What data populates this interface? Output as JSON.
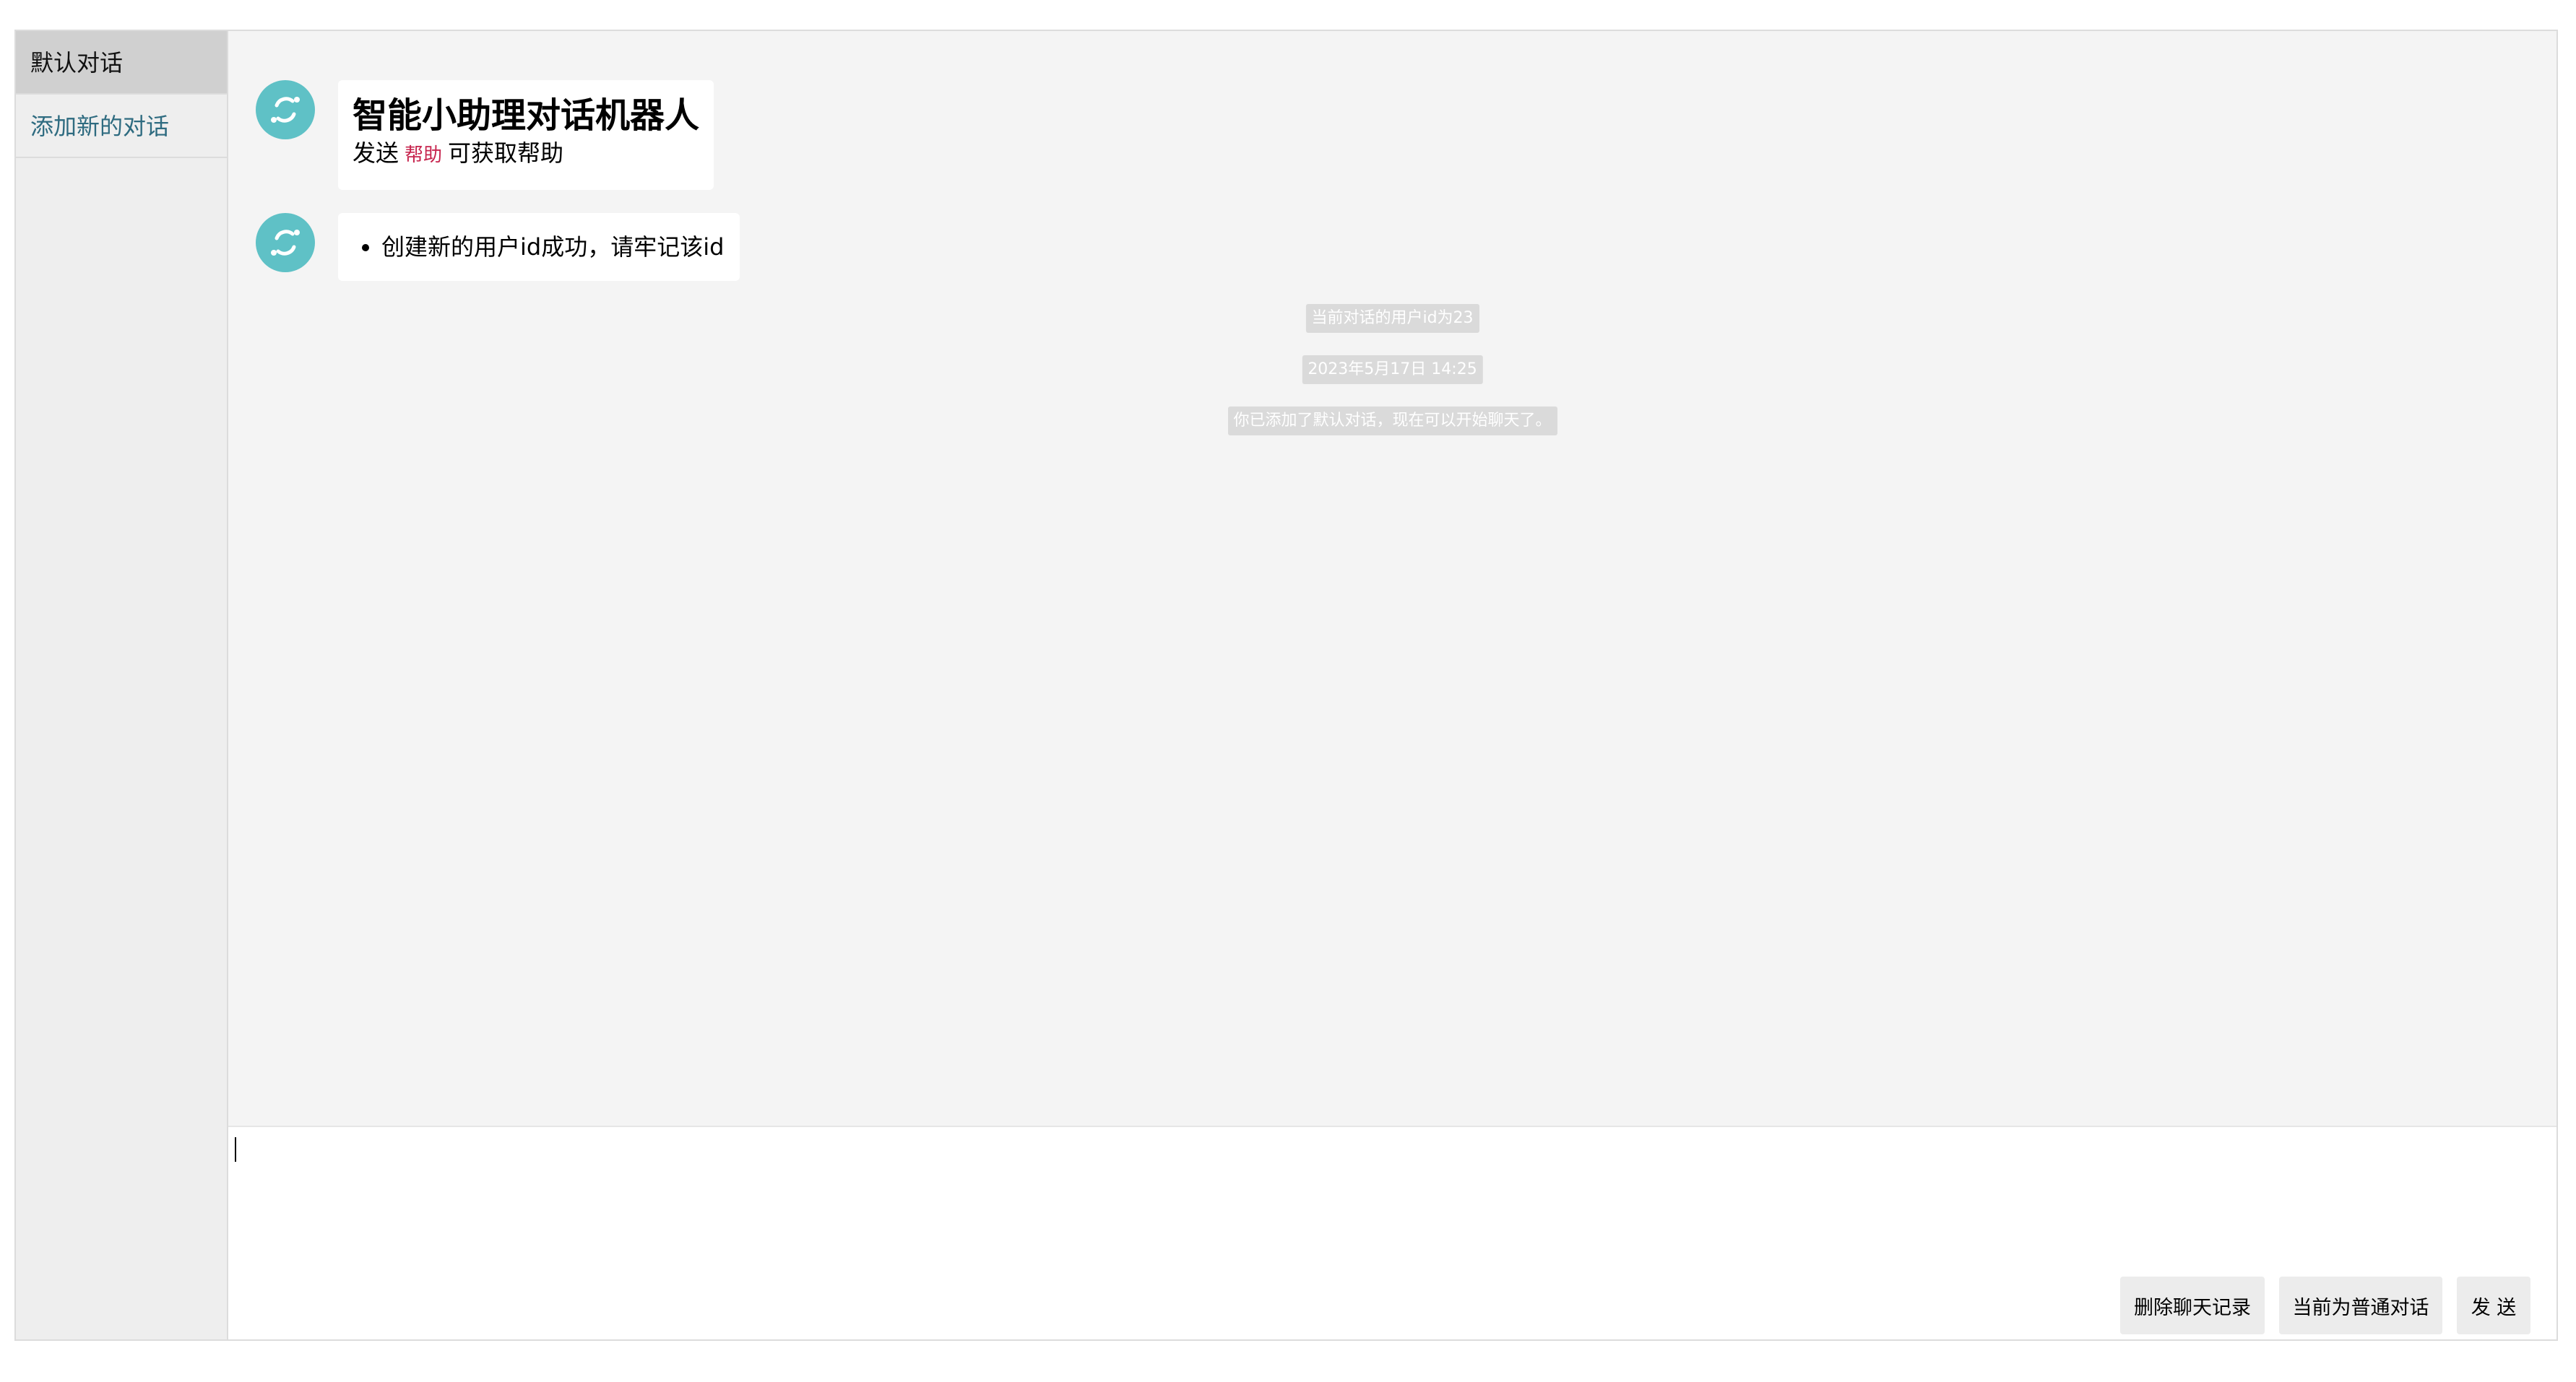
{
  "sidebar": {
    "items": [
      {
        "label": "默认对话",
        "active": true
      },
      {
        "label": "添加新的对话",
        "active": false
      }
    ]
  },
  "chat": {
    "messages": [
      {
        "avatar_icon": "sync-icon",
        "title": "智能小助理对话机器人",
        "sub_prefix": "发送",
        "sub_code": "帮助",
        "sub_suffix": "可获取帮助"
      },
      {
        "avatar_icon": "sync-icon",
        "list_item": "创建新的用户id成功，请牢记该id"
      }
    ],
    "system_notices": [
      "当前对话的用户id为23",
      "2023年5月17日 14:25",
      "你已添加了默认对话，现在可以开始聊天了。"
    ]
  },
  "input": {
    "value": ""
  },
  "actions": {
    "clear_label": "删除聊天记录",
    "mode_label": "当前为普通对话",
    "send_label": "发 送"
  },
  "colors": {
    "avatar_bg": "#5fc1c6",
    "help_code": "#c7254e",
    "add_link": "#2e6b80"
  }
}
